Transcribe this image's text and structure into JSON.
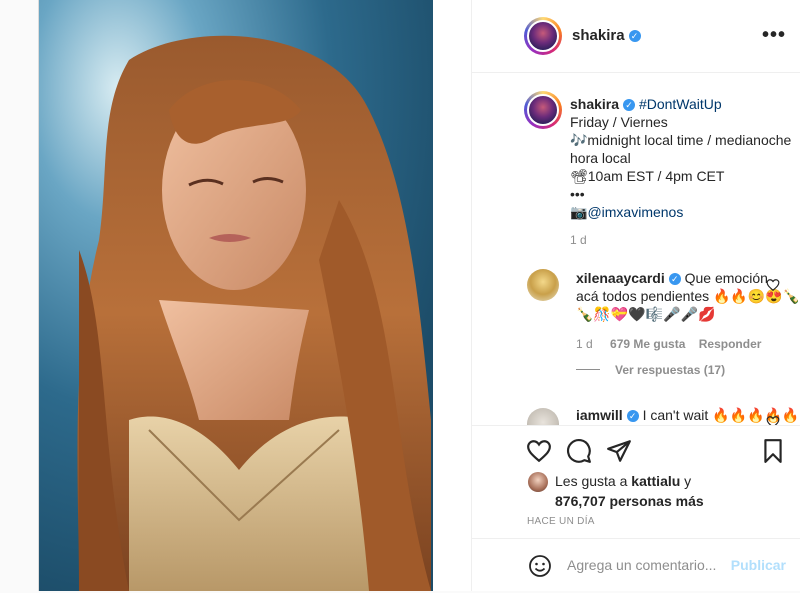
{
  "header": {
    "username": "shakira",
    "more_label": "•••"
  },
  "caption": {
    "username": "shakira",
    "hashtag": "#DontWaitUp",
    "lines": [
      "Friday / Viernes",
      "🎶midnight local time / medianoche",
      "hora local",
      "📽10am EST / 4pm CET",
      "•••"
    ],
    "mention_prefix": "📷",
    "mention": "@imxavimenos",
    "time": "1 d"
  },
  "comments": [
    {
      "username": "xilenaaycardi",
      "text_line1": "Que emoción",
      "text_line2": "acá todos pendientes 🔥🔥😊😍🍾",
      "text_line3": "🍾🎊💝🖤🎼🎤🎤💋",
      "time": "1 d",
      "likes": "679 Me gusta",
      "reply": "Responder",
      "view_replies": "Ver respuestas (17)"
    },
    {
      "username": "iamwill",
      "text": "I can't wait 🔥🔥🔥🔥🔥"
    }
  ],
  "likes": {
    "prefix": "Les gusta a ",
    "user": "kattialu",
    "conj": " y",
    "count": "876,707 personas más"
  },
  "post_time": "HACE UN DÍA",
  "add_comment": {
    "placeholder": "Agrega un comentario...",
    "publish": "Publicar"
  },
  "colors": {
    "verified": "#3897f0",
    "link": "#00376b",
    "muted": "#8e8e8e",
    "publish": "#b2dffc"
  },
  "icons": [
    "heart-icon",
    "comment-icon",
    "share-icon",
    "bookmark-icon",
    "emoji-icon",
    "verified-icon"
  ]
}
